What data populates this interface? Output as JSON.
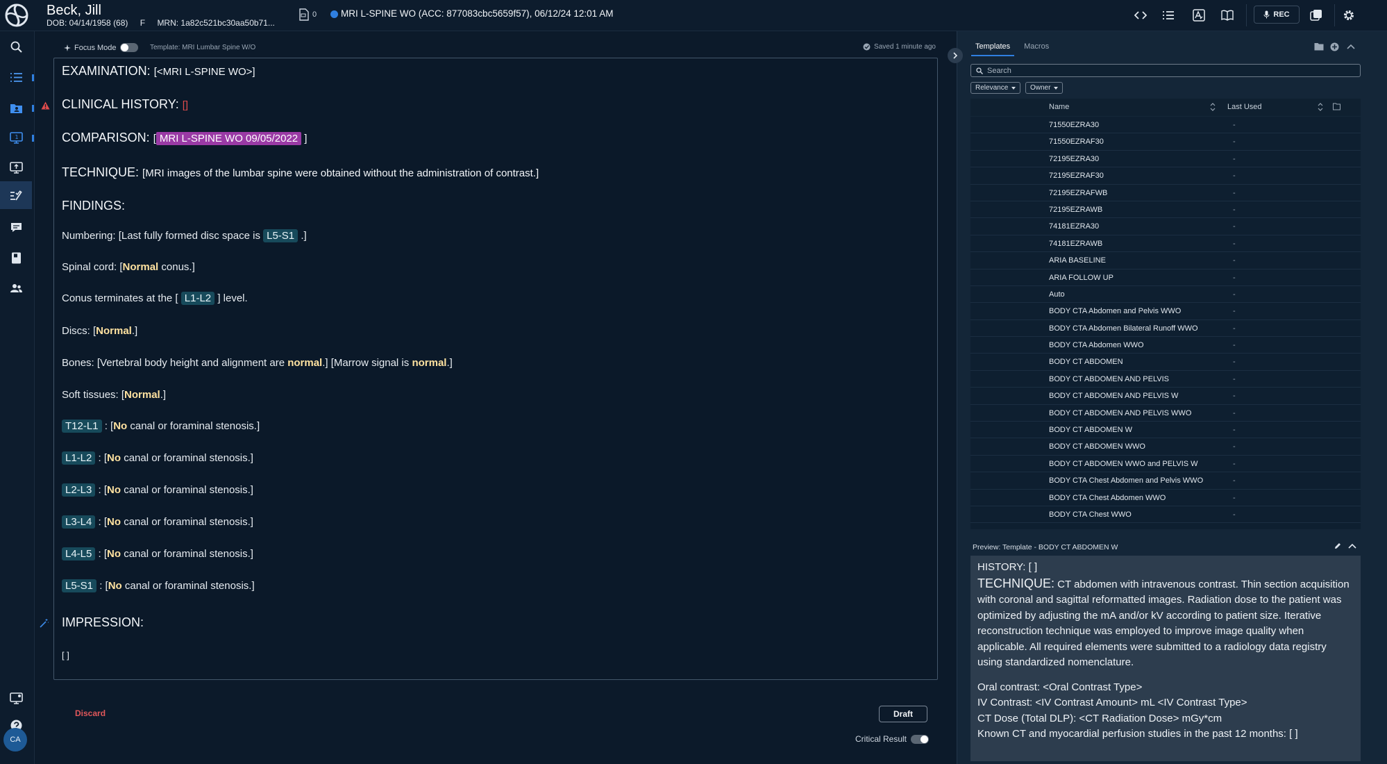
{
  "patient": {
    "name": "Beck, Jill",
    "dob": "DOB: 04/14/1958 (68)",
    "sex": "F",
    "mrn": "MRN: 1a82c521bc30aa50b71..."
  },
  "toolbar": {
    "doc_count": "0",
    "exam": "MRI L-SPINE WO (ACC: 877083cbc5659f57), 06/12/24 12:01 AM",
    "rec_label": "REC",
    "status_color": "#2f7fe0"
  },
  "user": {
    "initials": "CA"
  },
  "editor": {
    "focus_mode_label": "Focus Mode",
    "template_label": "Template: MRI Lumbar Spine W/O",
    "saved_status": "Saved 1 minute ago",
    "discard_label": "Discard",
    "draft_label": "Draft",
    "critical_result_label": "Critical Result"
  },
  "report": {
    "examination_label": "EXAMINATION:",
    "examination_value": "[<MRI L-SPINE WO>]",
    "clinical_history_label": "CLINICAL HISTORY:",
    "clinical_history_value": "[]",
    "comparison_label": "COMPARISON:",
    "comparison_value": "MRI L-SPINE WO 09/05/2022",
    "technique_label": "TECHNIQUE:",
    "technique_value": "[MRI images of the lumbar spine were obtained without the administration of contrast.]",
    "findings_label": "FINDINGS:",
    "numbering_pre": "Numbering: [Last fully formed disc space is",
    "numbering_tag": "L5-S1",
    "numbering_post": ".]",
    "spinal_cord_pre": "Spinal cord: [",
    "spinal_cord_bold": "Normal",
    "spinal_cord_post": " conus.]",
    "conus_pre": "Conus terminates at the [",
    "conus_tag": "L1-L2",
    "conus_post": "] level.",
    "discs_pre": "Discs: [",
    "discs_bold": "Normal",
    "discs_post": ".]",
    "bones_pre": "Bones: [Vertebral body height and alignment are ",
    "bones_bold1": "normal",
    "bones_mid": ".] [Marrow signal is ",
    "bones_bold2": "normal",
    "bones_post": ".]",
    "soft_pre": "Soft tissues: [",
    "soft_bold": "Normal",
    "soft_post": ".]",
    "levels": [
      {
        "tag": "T12-L1",
        "pre": " : [",
        "bold": "No",
        "post": " canal or foraminal stenosis.]"
      },
      {
        "tag": "L1-L2",
        "pre": " : [",
        "bold": "No",
        "post": " canal or foraminal stenosis.]"
      },
      {
        "tag": "L2-L3",
        "pre": " : [",
        "bold": "No",
        "post": " canal or foraminal stenosis.]"
      },
      {
        "tag": "L3-L4",
        "pre": " : [",
        "bold": "No",
        "post": " canal or foraminal stenosis.]"
      },
      {
        "tag": "L4-L5",
        "pre": " : [",
        "bold": "No",
        "post": " canal or foraminal stenosis.]"
      },
      {
        "tag": "L5-S1",
        "pre": " : [",
        "bold": "No",
        "post": " canal or foraminal stenosis.]"
      }
    ],
    "impression_label": "IMPRESSION:",
    "impression_value": "[ ]"
  },
  "panel": {
    "tab_templates": "Templates",
    "tab_macros": "Macros",
    "search_placeholder": "Search",
    "sort_relevance": "Relevance",
    "filter_owner": "Owner",
    "col_name": "Name",
    "col_last_used": "Last Used",
    "rows": [
      {
        "name": "71550EZRA30",
        "last_used": "-"
      },
      {
        "name": "71550EZRAF30",
        "last_used": "-"
      },
      {
        "name": "72195EZRA30",
        "last_used": "-"
      },
      {
        "name": "72195EZRAF30",
        "last_used": "-"
      },
      {
        "name": "72195EZRAFWB",
        "last_used": "-"
      },
      {
        "name": "72195EZRAWB",
        "last_used": "-"
      },
      {
        "name": "74181EZRA30",
        "last_used": "-"
      },
      {
        "name": "74181EZRAWB",
        "last_used": "-"
      },
      {
        "name": "ARIA BASELINE",
        "last_used": "-"
      },
      {
        "name": "ARIA FOLLOW UP",
        "last_used": "-"
      },
      {
        "name": "Auto",
        "last_used": "-"
      },
      {
        "name": "BODY CTA Abdomen and Pelvis WWO",
        "last_used": "-"
      },
      {
        "name": "BODY CTA Abdomen Bilateral Runoff WWO",
        "last_used": "-"
      },
      {
        "name": "BODY CTA Abdomen WWO",
        "last_used": "-"
      },
      {
        "name": "BODY CT ABDOMEN",
        "last_used": "-"
      },
      {
        "name": "BODY CT ABDOMEN AND PELVIS",
        "last_used": "-"
      },
      {
        "name": "BODY CT ABDOMEN AND PELVIS W",
        "last_used": "-"
      },
      {
        "name": "BODY CT ABDOMEN AND PELVIS WWO",
        "last_used": "-"
      },
      {
        "name": "BODY CT ABDOMEN W",
        "last_used": "-"
      },
      {
        "name": "BODY CT ABDOMEN WWO",
        "last_used": "-"
      },
      {
        "name": "BODY CT ABDOMEN WWO and PELVIS W",
        "last_used": "-"
      },
      {
        "name": "BODY CTA Chest Abdomen and Pelvis WWO",
        "last_used": "-"
      },
      {
        "name": "BODY CTA Chest Abdomen WWO",
        "last_used": "-"
      },
      {
        "name": "BODY CTA Chest WWO",
        "last_used": "-"
      }
    ],
    "preview_header": "Preview: Template - BODY CT ABDOMEN W",
    "preview": {
      "history": "HISTORY: [ ]",
      "technique_label": "TECHNIQUE:",
      "technique_text": " CT abdomen with intravenous contrast. Thin section acquisition with coronal and sagittal reformatted images. Radiation dose to the patient was optimized by adjusting the mA and/or kV according to patient size. Iterative reconstruction technique was employed to improve image quality when applicable. All required elements were submitted to a radiology data registry using standardized nomenclature.",
      "oral": "Oral contrast: <Oral Contrast Type>",
      "iv": "IV Contrast: <IV Contrast Amount> mL <IV Contrast Type>",
      "dose": "CT Dose (Total DLP): <CT Radiation Dose> mGy*cm",
      "known": "Known CT and myocardial perfusion studies in the past 12 months: [ ]"
    }
  }
}
